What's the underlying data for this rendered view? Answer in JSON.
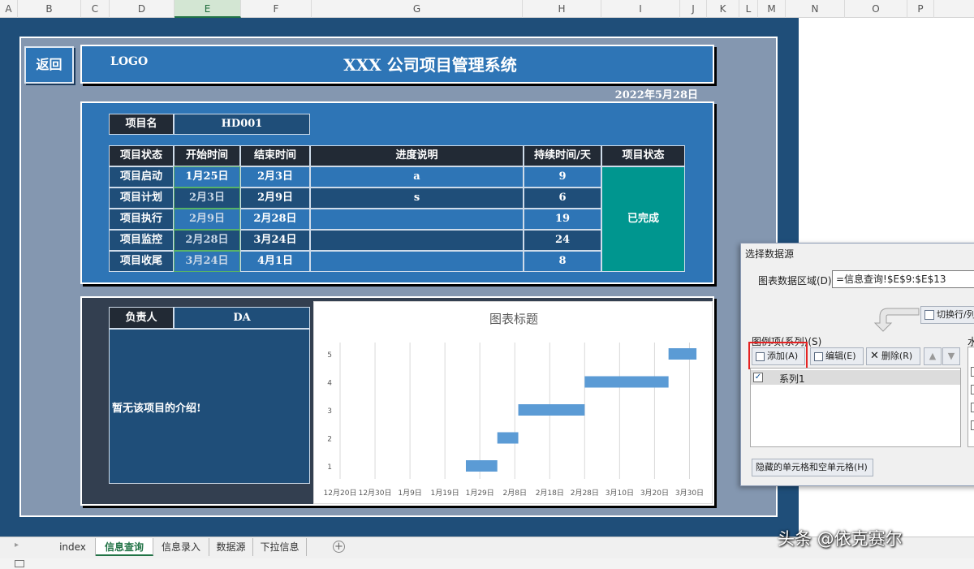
{
  "columns": [
    "A",
    "B",
    "C",
    "D",
    "E",
    "F",
    "G",
    "H",
    "I",
    "J",
    "K",
    "L",
    "M",
    "N",
    "O",
    "P"
  ],
  "selected_column": "E",
  "header": {
    "back_label": "返回",
    "logo": "LOGO",
    "title": "XXX 公司项目管理系统",
    "date": "2022年5月28日"
  },
  "project": {
    "name_label": "项目名",
    "name_value": "HD001",
    "table_headers": [
      "项目状态",
      "开始时间",
      "结束时间",
      "进度说明",
      "持续时间/天",
      "项目状态"
    ],
    "rows": [
      {
        "stage": "项目启动",
        "start": "1月25日",
        "end": "2月3日",
        "note": "a",
        "days": "9"
      },
      {
        "stage": "项目计划",
        "start": "2月3日",
        "end": "2月9日",
        "note": "s",
        "days": "6"
      },
      {
        "stage": "项目执行",
        "start": "2月9日",
        "end": "2月28日",
        "note": "",
        "days": "19"
      },
      {
        "stage": "项目监控",
        "start": "2月28日",
        "end": "3月24日",
        "note": "",
        "days": "24"
      },
      {
        "stage": "项目收尾",
        "start": "3月24日",
        "end": "4月1日",
        "note": "",
        "days": "8"
      }
    ],
    "status": "已完成"
  },
  "owner": {
    "label": "负责人",
    "value": "DA",
    "intro": "暂无该项目的介绍!"
  },
  "chart_data": {
    "type": "bar",
    "orientation": "horizontal",
    "title": "图表标题",
    "categories": [
      "1",
      "2",
      "3",
      "4",
      "5"
    ],
    "series": [
      {
        "starts": [
          "2022-01-25",
          "2022-02-03",
          "2022-02-09",
          "2022-02-28",
          "2022-03-24"
        ],
        "ends": [
          "2022-02-03",
          "2022-02-09",
          "2022-02-28",
          "2022-03-24",
          "2022-04-01"
        ]
      }
    ],
    "x_ticks": [
      "12月20日",
      "12月30日",
      "1月9日",
      "1月19日",
      "1月29日",
      "2月8日",
      "2月18日",
      "2月28日",
      "3月10日",
      "3月20日",
      "3月30日"
    ],
    "xlim": [
      "2021-12-20",
      "2022-04-04"
    ],
    "grid": true,
    "bar_color": "#5b9bd5"
  },
  "dialog": {
    "title": "选择数据源",
    "range_label": "图表数据区域(D):",
    "range_value": "=信息查询!$E$9:$E$13",
    "switch_button": "切换行/列(W)",
    "legend_label": "图例项(系列)(S)",
    "horizontal_label": "水",
    "add_button": "添加(A)",
    "edit_button": "编辑(E)",
    "delete_button": "删除(R)",
    "series_name": "系列1",
    "hidden_cells_button": "隐藏的单元格和空单元格(H)"
  },
  "tabs": [
    "index",
    "信息查询",
    "信息录入",
    "数据源",
    "下拉信息"
  ],
  "active_tab": "信息查询",
  "watermark": "头条 @依克赛尔",
  "colors": {
    "sheet_bg": "#1f4e79",
    "panel": "#2e75b6",
    "dark_cell": "#222a35",
    "status": "#00968f"
  }
}
